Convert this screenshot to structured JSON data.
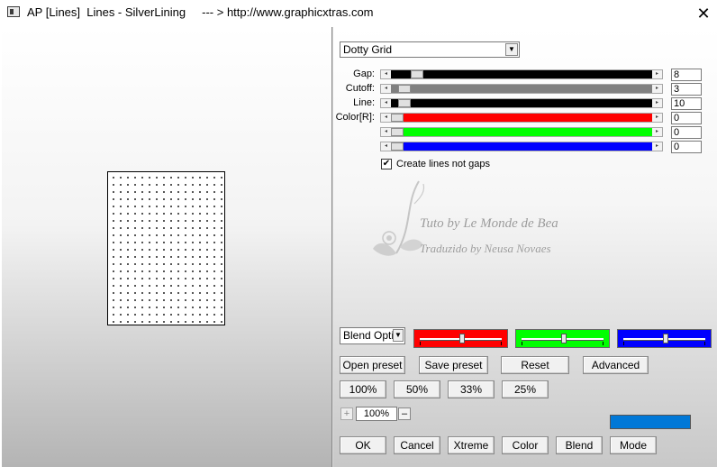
{
  "window": {
    "title": "AP [Lines]  Lines - SilverLining     --- > http://www.graphicxtras.com",
    "close_glyph": "✕"
  },
  "preset": {
    "selected": "Dotty Grid"
  },
  "sliders": [
    {
      "label": "Gap:",
      "value": "8",
      "position": 0.08,
      "track_color": "#000000"
    },
    {
      "label": "Cutoff:",
      "value": "3",
      "position": 0.03,
      "track_color": "#808080"
    },
    {
      "label": "Line:",
      "value": "10",
      "position": 0.03,
      "track_color": "#000000"
    },
    {
      "label": "Color[R]:",
      "value": "0",
      "position": 0.0,
      "track_color": "#ff0000"
    },
    {
      "label": "",
      "value": "0",
      "position": 0.0,
      "track_color": "#00ff00"
    },
    {
      "label": "",
      "value": "0",
      "position": 0.0,
      "track_color": "#0000ff"
    }
  ],
  "checkbox": {
    "label": "Create lines not gaps",
    "checked": true,
    "glyph": "✔"
  },
  "watermark": {
    "line1": "Tuto by Le Monde de Bea",
    "line2": "Traduzido by Neusa Novaes"
  },
  "blend": {
    "selected": "Blend Optio",
    "panels": [
      {
        "color": "#ff0000",
        "level": 0.5
      },
      {
        "color": "#00ff00",
        "level": 0.5
      },
      {
        "color": "#0000ff",
        "level": 0.5
      }
    ]
  },
  "buttons_row1": [
    "Open preset",
    "Save preset",
    "Reset",
    "Advanced"
  ],
  "zoom_buttons": [
    "100%",
    "50%",
    "33%",
    "25%"
  ],
  "zoom": {
    "value": "100%",
    "plus": "+",
    "minus": "–"
  },
  "selected_color": "#0078d7",
  "bottom_buttons": [
    "OK",
    "Cancel",
    "Xtreme",
    "Color",
    "Blend",
    "Mode"
  ],
  "icons": {
    "app": "app-icon",
    "close": "close-icon",
    "dropdown": "chevron-down-icon",
    "slider_left": "arrow-left-icon",
    "slider_right": "arrow-right-icon"
  }
}
